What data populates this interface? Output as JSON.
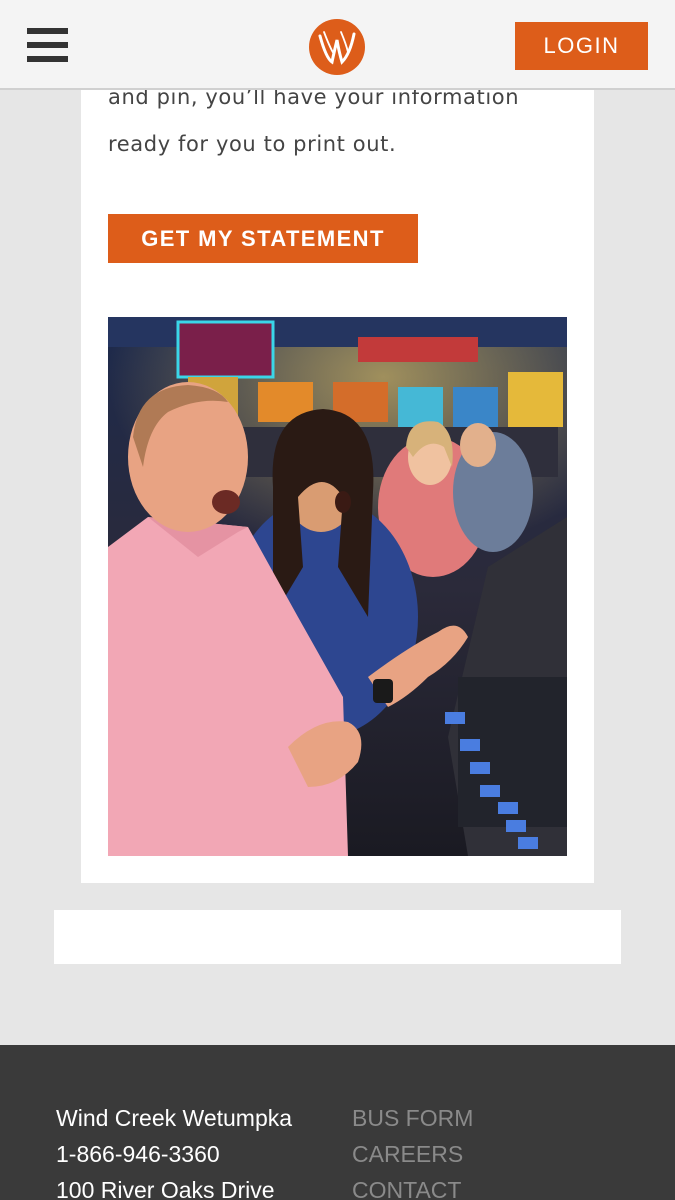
{
  "header": {
    "menu_icon": "hamburger-menu-icon",
    "logo_icon": "wind-creek-logo",
    "login_label": "LOGIN",
    "brand_color": "#dd5d1a"
  },
  "content": {
    "text_line_1": "and pin, you’ll have your information",
    "text_line_2": "ready for you to print out.",
    "statement_button_label": "GET MY STATEMENT",
    "photo_icon": "casino-players-photo"
  },
  "footer": {
    "venue_name": "Wind Creek Wetumpka",
    "phone": "1-866-946-3360",
    "address": "100 River Oaks Drive",
    "links": [
      "BUS FORM",
      "CAREERS",
      "CONTACT"
    ]
  }
}
